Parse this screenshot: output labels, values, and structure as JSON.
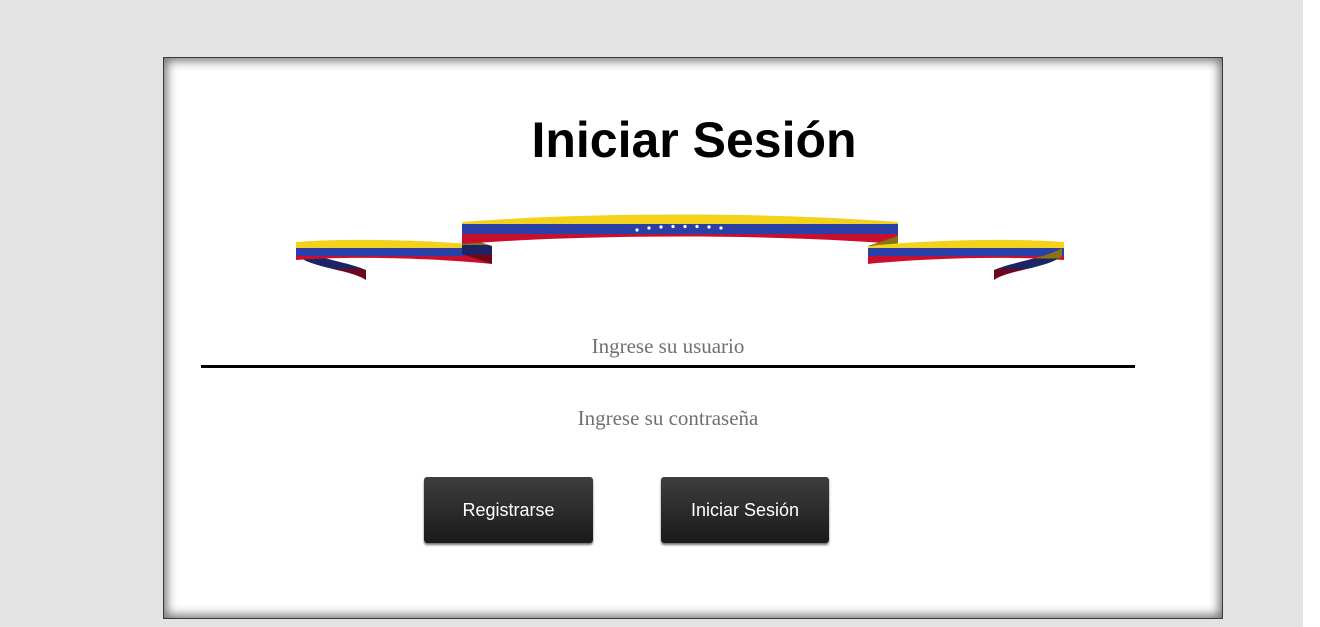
{
  "login_card": {
    "title": "Iniciar Sesión",
    "flag_ribbon_icon": "venezuela-flag-ribbon",
    "flag_colors": {
      "yellow": "#f2d21a",
      "blue": "#2a3fa8",
      "red": "#c8102e",
      "stars": "#ffffff"
    },
    "username_placeholder": "Ingrese su usuario",
    "username_value": "",
    "password_placeholder": "Ingrese su contraseña",
    "password_value": "",
    "register_label": "Registrarse",
    "login_label": "Iniciar Sesión"
  },
  "colors": {
    "page_background": "#e3e3e3",
    "card_background": "#ffffff",
    "button_background": "#2b2b2b",
    "button_text": "#ffffff"
  }
}
